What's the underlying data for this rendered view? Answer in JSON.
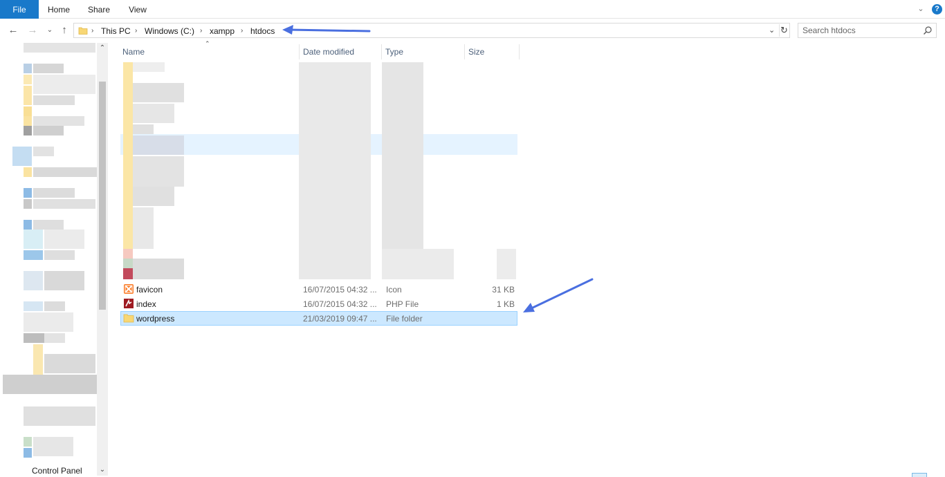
{
  "ribbon": {
    "tabs": [
      "File",
      "Home",
      "Share",
      "View"
    ],
    "help_label": "?"
  },
  "address": {
    "crumbs": [
      "This PC",
      "Windows (C:)",
      "xampp",
      "htdocs"
    ]
  },
  "search": {
    "placeholder": "Search htdocs"
  },
  "columns": {
    "name": "Name",
    "date": "Date modified",
    "type": "Type",
    "size": "Size"
  },
  "files": [
    {
      "name": "favicon",
      "date": "16/07/2015 04:32 ...",
      "type": "Icon",
      "size": "31 KB",
      "icon": "xampp-icon"
    },
    {
      "name": "index",
      "date": "16/07/2015 04:32 ...",
      "type": "PHP File",
      "size": "1 KB",
      "icon": "php-file-icon"
    },
    {
      "name": "wordpress",
      "date": "21/03/2019 09:47 ...",
      "type": "File folder",
      "size": "",
      "icon": "folder-icon"
    }
  ],
  "nav_pane": {
    "last_item": "Control Panel"
  },
  "colors": {
    "accent": "#1979ca",
    "selection": "#cce8ff",
    "annotation_arrow": "#4a6fe0",
    "folder": "#f8d775"
  }
}
